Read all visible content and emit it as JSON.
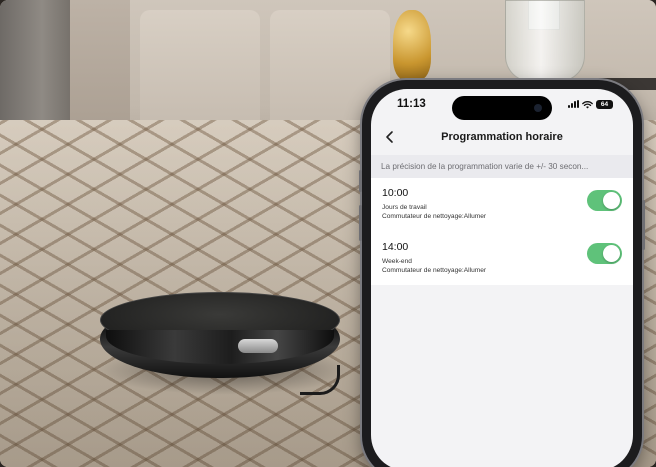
{
  "status_bar": {
    "time": "11:13",
    "battery": "64"
  },
  "header": {
    "title": "Programmation horaire"
  },
  "notice": "La précision de la programmation varie de +/- 30 secon...",
  "schedules": [
    {
      "time": "10:00",
      "days": "Jours de travail",
      "action": "Commutateur de nettoyage:Allumer",
      "enabled": true
    },
    {
      "time": "14:00",
      "days": "Week-end",
      "action": "Commutateur de nettoyage:Allumer",
      "enabled": true
    }
  ],
  "colors": {
    "toggle_on": "#5fc27a",
    "screen_bg": "#f3f3f5"
  },
  "icons": [
    "back-chevron-icon",
    "signal-icon",
    "wifi-icon",
    "battery-icon"
  ]
}
